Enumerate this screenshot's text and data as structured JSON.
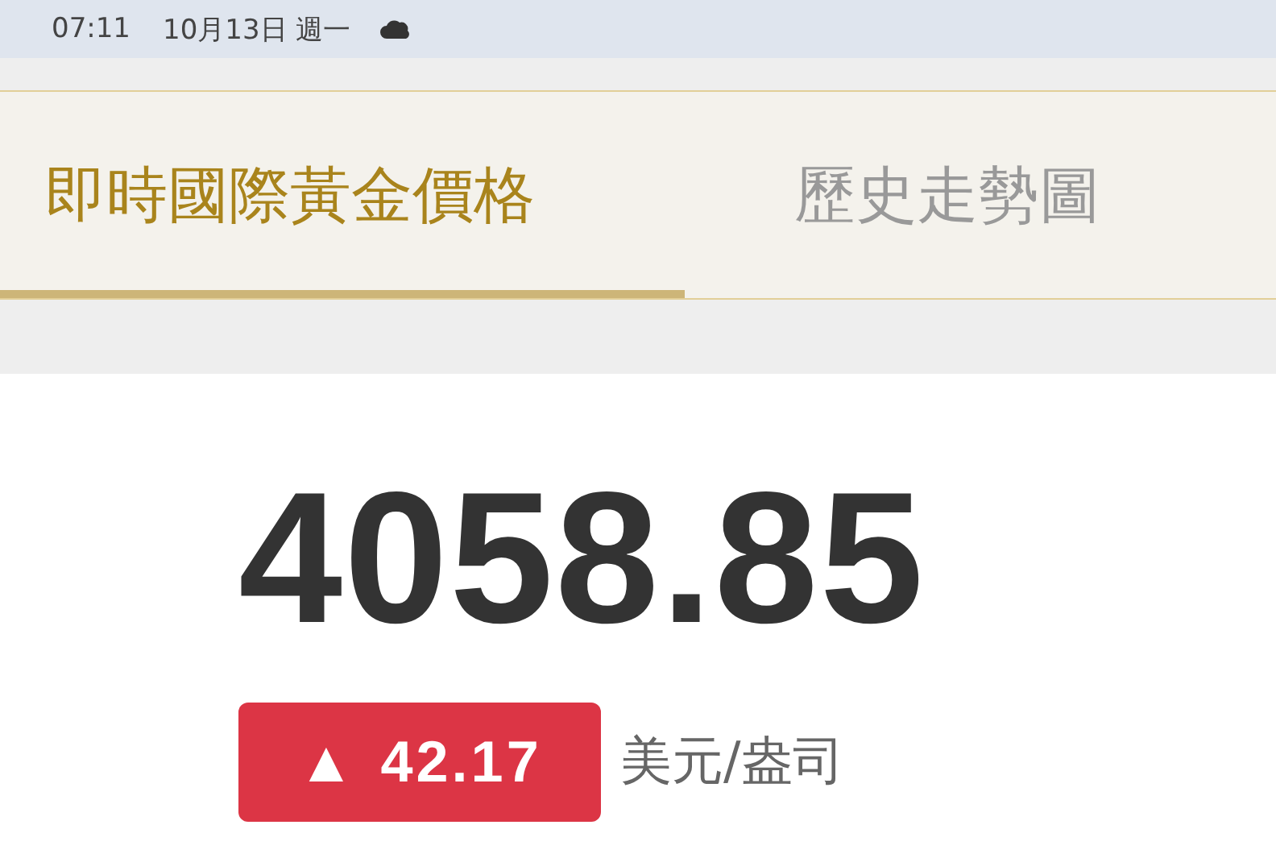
{
  "status_bar": {
    "time": "07:11",
    "date": "10月13日 週一"
  },
  "tabs": [
    {
      "label": "即時國際黃金價格",
      "selected": true
    },
    {
      "label": "歷史走勢圖",
      "selected": false
    }
  ],
  "quote": {
    "price": "4058.85",
    "change": {
      "arrow": "▲",
      "value": "42.17"
    },
    "unit": "美元/盎司"
  }
}
